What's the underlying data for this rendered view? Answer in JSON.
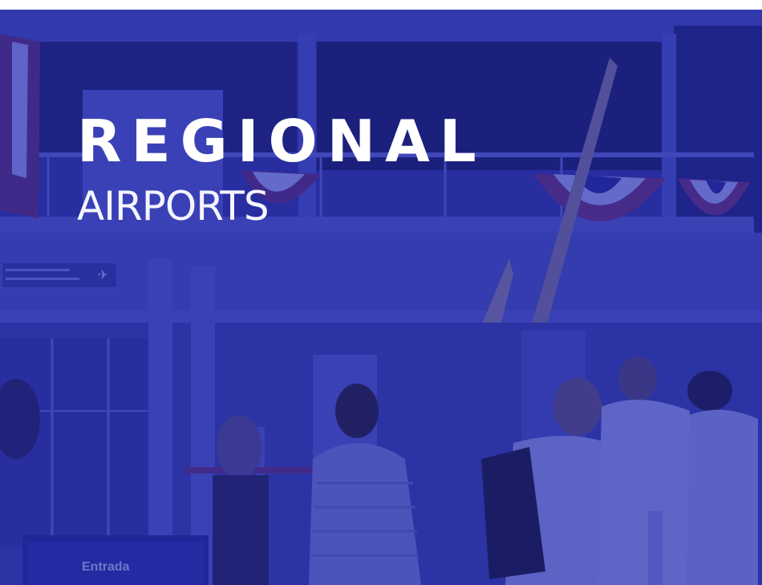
{
  "hero": {
    "title_main": "REGIONAL",
    "title_sub": "AIRPORTS",
    "photo_sign_text": "Entrada",
    "overlay_color": "#2830aa"
  },
  "icons": {
    "airplane_sign": "airplane-icon"
  }
}
